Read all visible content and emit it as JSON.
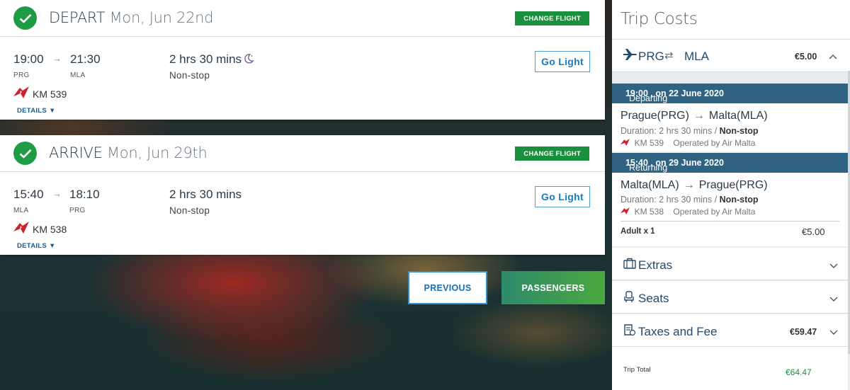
{
  "depart": {
    "label": "DEPART",
    "date": "Mon, Jun 22nd",
    "change_label": "CHANGE FLIGHT",
    "dep_time": "19:00",
    "arr_time": "21:30",
    "arrow": "→",
    "dep_code": "PRG",
    "arr_code": "MLA",
    "duration": "2 hrs 30 mins",
    "stops": "Non-stop",
    "flight_no": "KM 539",
    "details": "DETAILS",
    "fare_button": "Go Light",
    "overnight_icon": "moon-icon"
  },
  "arrive": {
    "label": "ARRIVE",
    "date": "Mon, Jun 29th",
    "change_label": "CHANGE FLIGHT",
    "dep_time": "15:40",
    "arr_time": "18:10",
    "arrow": "→",
    "dep_code": "MLA",
    "arr_code": "PRG",
    "duration": "2 hrs 30 mins",
    "stops": "Non-stop",
    "flight_no": "KM 538",
    "details": "DETAILS",
    "fare_button": "Go Light"
  },
  "nav": {
    "previous": "PREVIOUS",
    "next": "PASSENGERS"
  },
  "sidebar": {
    "title": "Trip Costs",
    "route": {
      "from": "PRG",
      "swap": "⇄",
      "to": "MLA",
      "price": "€5.00"
    },
    "departing": {
      "prefix": "Departing",
      "when": "19:00 , on 22 June 2020",
      "from": "Prague(PRG)",
      "arrow": "→",
      "to": "Malta(MLA)",
      "duration": "Duration: 2 hrs 30 mins /",
      "stops": "Non-stop",
      "flight": "KM 539",
      "operated": "Operated by Air Malta"
    },
    "returning": {
      "prefix": "Returning",
      "when": "15:40 , on 29 June 2020",
      "from": "Malta(MLA)",
      "arrow": "→",
      "to": "Prague(PRG)",
      "duration": "Duration: 2 hrs 30 mins /",
      "stops": "Non-stop",
      "flight": "KM 538",
      "operated": "Operated by Air Malta"
    },
    "adult": {
      "label": "Adult x 1",
      "price": "€5.00"
    },
    "extras": {
      "label": "Extras"
    },
    "seats": {
      "label": "Seats"
    },
    "taxes": {
      "label": "Taxes and Fee",
      "price": "€59.47"
    },
    "total": {
      "label": "Trip Total",
      "price": "€64.47"
    }
  },
  "colors": {
    "brand_green": "#1a8f3d",
    "navy": "#2f6381",
    "link_blue": "#1a7bc0",
    "airline_red": "#d0202e"
  }
}
